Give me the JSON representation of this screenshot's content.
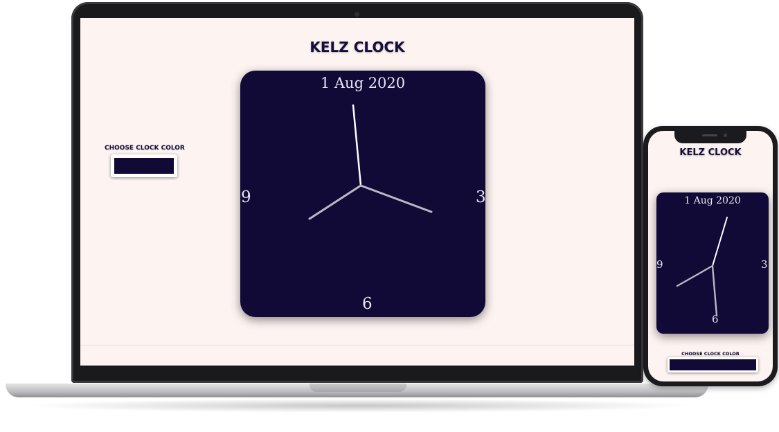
{
  "app_title": "KELZ CLOCK",
  "clock": {
    "date": "1 Aug 2020",
    "numbers": {
      "nine": "9",
      "three": "3",
      "six": "6"
    },
    "face_color": "#110a37",
    "hand_colors": {
      "primary": "#ffffff",
      "secondary": "#b9b9c2"
    }
  },
  "color_picker": {
    "label": "CHOOSE CLOCK COLOR",
    "value": "#110a37"
  }
}
